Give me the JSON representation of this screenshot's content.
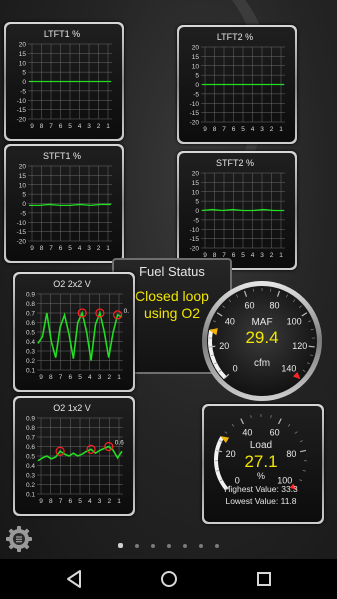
{
  "widgets": {
    "ltft1": {
      "label": "LTFT1 %",
      "ticks": [
        "20",
        "15",
        "10",
        "5",
        "0",
        "-5",
        "-10",
        "-15",
        "-20"
      ],
      "xlabels": [
        "9",
        "8",
        "7",
        "6",
        "5",
        "4",
        "3",
        "2",
        "1"
      ],
      "series": [
        0,
        0,
        0,
        0,
        0,
        0,
        0,
        0,
        0
      ]
    },
    "ltft2": {
      "label": "LTFT2 %",
      "ticks": [
        "20",
        "15",
        "10",
        "5",
        "0",
        "-5",
        "-10",
        "-15",
        "-20"
      ],
      "xlabels": [
        "9",
        "8",
        "7",
        "6",
        "5",
        "4",
        "3",
        "2",
        "1"
      ],
      "series": [
        0,
        0,
        0,
        0,
        0,
        0,
        0,
        0,
        0
      ]
    },
    "stft1": {
      "label": "STFT1 %",
      "ticks": [
        "20",
        "15",
        "10",
        "5",
        "0",
        "-5",
        "-10",
        "-15",
        "-20"
      ],
      "xlabels": [
        "9",
        "8",
        "7",
        "6",
        "5",
        "4",
        "3",
        "2",
        "1"
      ],
      "series": [
        -1,
        -1,
        -0.5,
        -1,
        -1,
        -0.5,
        -1,
        -0.5,
        -0.5
      ]
    },
    "stft2": {
      "label": "STFT2 %",
      "ticks": [
        "20",
        "15",
        "10",
        "5",
        "0",
        "-5",
        "-10",
        "-15",
        "-20"
      ],
      "xlabels": [
        "9",
        "8",
        "7",
        "6",
        "5",
        "4",
        "3",
        "2",
        "1"
      ],
      "series": [
        0,
        0.5,
        0,
        0.5,
        0,
        0,
        0.5,
        0,
        0
      ]
    },
    "o2b2s2": {
      "label": "O2 2x2 V",
      "ticks": [
        "0.9",
        "0.8",
        "0.7",
        "0.6",
        "0.5",
        "0.4",
        "0.3",
        "0.2",
        "0.1"
      ],
      "xlabels": [
        "9",
        "8",
        "7",
        "6",
        "5",
        "4",
        "3",
        "2",
        "1"
      ],
      "max_label": "0.7",
      "series": [
        0.38,
        0.45,
        0.7,
        0.4,
        0.23,
        0.55,
        0.68,
        0.48,
        0.22,
        0.6,
        0.7,
        0.5,
        0.2,
        0.58,
        0.7,
        0.5,
        0.23,
        0.5,
        0.68,
        0.66
      ]
    },
    "o2b1s2": {
      "label": "O2 1x2 V",
      "ticks": [
        "0.9",
        "0.8",
        "0.7",
        "0.6",
        "0.5",
        "0.4",
        "0.3",
        "0.2",
        "0.1"
      ],
      "xlabels": [
        "9",
        "8",
        "7",
        "6",
        "5",
        "4",
        "3",
        "2",
        "1"
      ],
      "max_label": "0.6",
      "series": [
        0.45,
        0.48,
        0.5,
        0.47,
        0.49,
        0.55,
        0.52,
        0.5,
        0.53,
        0.5,
        0.52,
        0.55,
        0.57,
        0.53,
        0.56,
        0.58,
        0.6,
        0.56,
        0.48,
        0.55
      ]
    }
  },
  "fuel_status": {
    "title": "Fuel Status",
    "value": "Closed loop\nusing O2"
  },
  "maf_gauge": {
    "label": "MAF",
    "value": "29.4",
    "unit": "cfm",
    "scale": [
      "0",
      "20",
      "40",
      "60",
      "80",
      "100",
      "120",
      "140"
    ],
    "min": 0,
    "max": 140,
    "reading": 29.4
  },
  "load_gauge": {
    "label": "Load",
    "value": "27.1",
    "unit": "%",
    "scale": [
      "0",
      "20",
      "40",
      "60",
      "80",
      "100"
    ],
    "min": 0,
    "max": 100,
    "reading": 27.1,
    "highest_label": "Highest Value: 33.3",
    "lowest_label": "Lowest Value: 11.8"
  },
  "pager": {
    "count": 7,
    "active": 0
  },
  "colors": {
    "line": "#22dd22",
    "value": "#f2e600",
    "peak": "#ff2222",
    "grid": "#6a6a6a"
  }
}
